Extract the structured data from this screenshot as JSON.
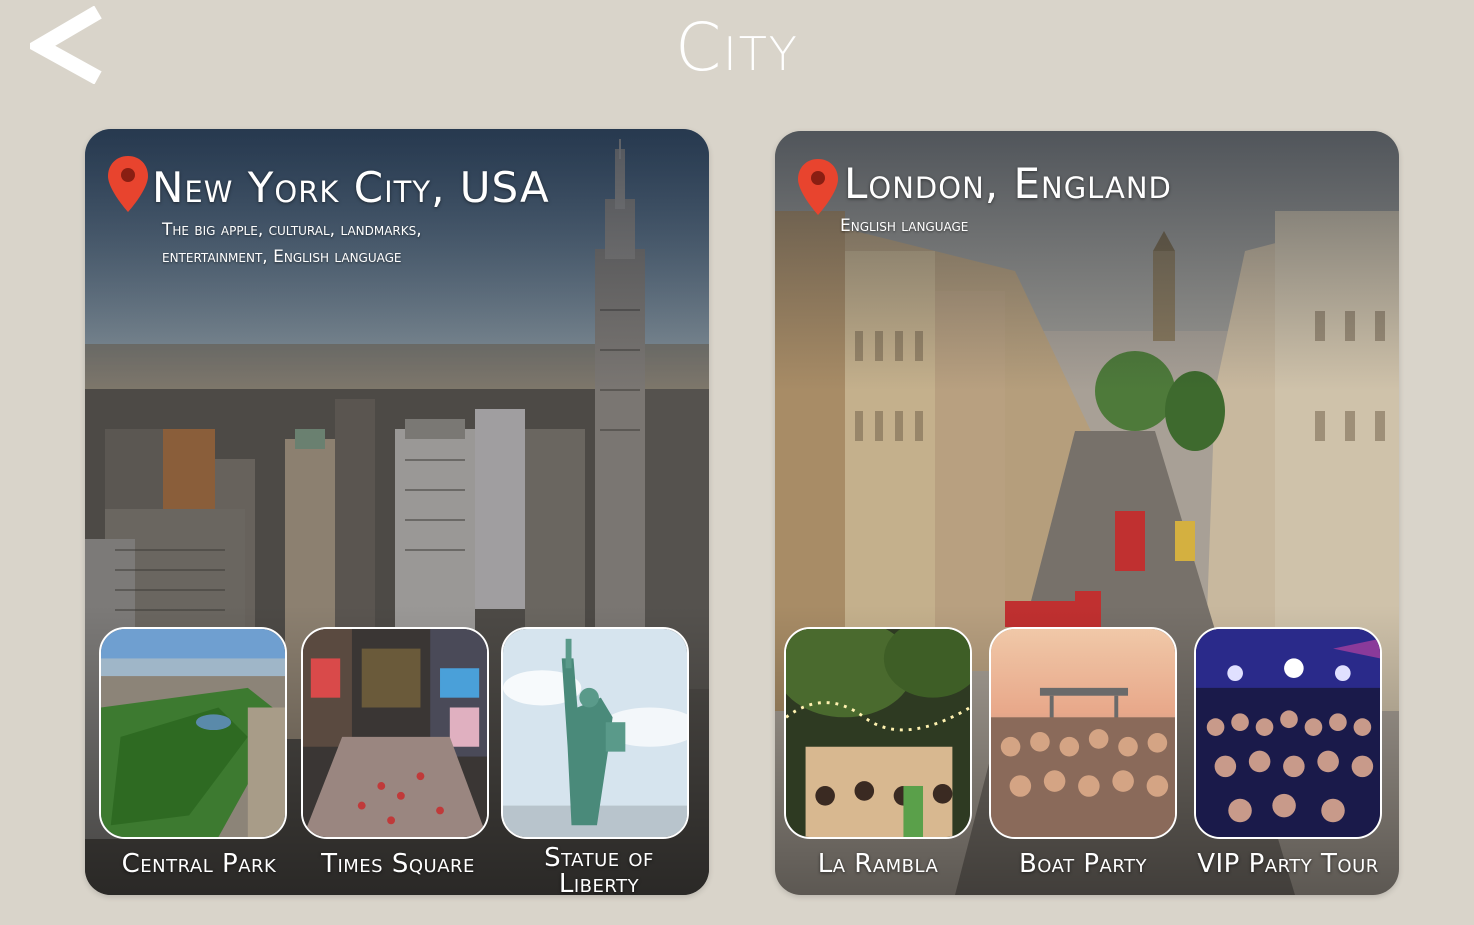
{
  "header": {
    "title": "City",
    "back_icon": "chevron-left-icon"
  },
  "cities": [
    {
      "name": "New York City, USA",
      "description_line1": "The big apple, cultural, landmarks,",
      "description_line2": "entertainment, English language",
      "icon": "location-pin-icon",
      "attractions": [
        {
          "label": "Central Park"
        },
        {
          "label": "Times Square"
        },
        {
          "label_line1": "Statue of",
          "label_line2": "Liberty"
        }
      ]
    },
    {
      "name": "London, England",
      "description_line1": "English language",
      "icon": "location-pin-icon",
      "attractions": [
        {
          "label": "La Rambla"
        },
        {
          "label": "Boat Party"
        },
        {
          "label": "VIP Party Tour"
        }
      ]
    }
  ],
  "colors": {
    "background": "#d9d4ca",
    "pin": "#e8442e",
    "text": "#ffffff"
  }
}
